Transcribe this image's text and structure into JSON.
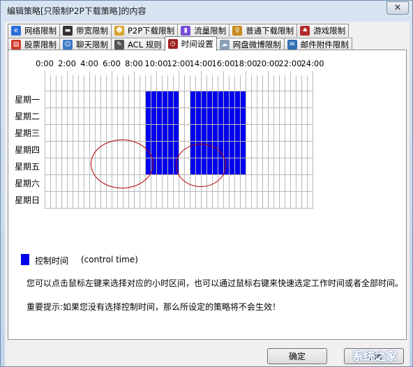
{
  "window": {
    "title": "编辑策略[只限制P2P下载策略]的内容",
    "close_label": "✕"
  },
  "tabs_row1": [
    {
      "label": "网络限制",
      "icon": "ie-globe-icon",
      "color": "#2a6fd6",
      "glyph": "e"
    },
    {
      "label": "带宽限制",
      "icon": "monitor-icon",
      "color": "#333333",
      "glyph": "▬"
    },
    {
      "label": "P2P下载限制",
      "icon": "user-icon",
      "color": "#d9a531",
      "glyph": "☻"
    },
    {
      "label": "流量限制",
      "icon": "bar-chart-icon",
      "color": "#7a4fd8",
      "glyph": "▮"
    },
    {
      "label": "普通下载限制",
      "icon": "person-icon",
      "color": "#c98a1c",
      "glyph": "♀"
    },
    {
      "label": "游戏限制",
      "icon": "game-icon",
      "color": "#b52b2b",
      "glyph": "♠"
    }
  ],
  "tabs_row2": [
    {
      "label": "股票限制",
      "icon": "stock-icon",
      "color": "#d23b2b",
      "glyph": "▤"
    },
    {
      "label": "聊天限制",
      "icon": "chat-icon",
      "color": "#3a7ac8",
      "glyph": "☺"
    },
    {
      "label": "ACL 规则",
      "icon": "acl-icon",
      "color": "#555555",
      "glyph": "✎"
    },
    {
      "label": "时间设置",
      "icon": "clock-icon",
      "color": "#a02020",
      "glyph": "◷",
      "active": true
    },
    {
      "label": "网盘微博限制",
      "icon": "cloud-icon",
      "color": "#8aa0b8",
      "glyph": "☁"
    },
    {
      "label": "邮件附件限制",
      "icon": "mail-icon",
      "color": "#2f6fb5",
      "glyph": "✉"
    }
  ],
  "schedule": {
    "hour_labels": [
      "0:00",
      "2:00",
      "4:00",
      "6:00",
      "8:00",
      "10:00",
      "12:00",
      "14:00",
      "16:00",
      "18:00",
      "20:00",
      "22:00",
      "24:00"
    ],
    "days": [
      "星期一",
      "星期二",
      "星期三",
      "星期四",
      "星期五",
      "星期六",
      "星期日"
    ],
    "slots_per_day": 48,
    "selected": {
      "星期一": [
        [
          18,
          23
        ],
        [
          26,
          35
        ]
      ],
      "星期二": [
        [
          18,
          23
        ],
        [
          26,
          35
        ]
      ],
      "星期三": [
        [
          18,
          23
        ],
        [
          26,
          35
        ]
      ],
      "星期四": [
        [
          18,
          23
        ],
        [
          26,
          35
        ]
      ],
      "星期五": [
        [
          18,
          23
        ],
        [
          26,
          35
        ]
      ],
      "星期六": [],
      "星期日": []
    },
    "selected_color": "#0000ee"
  },
  "legend": {
    "label": "控制时间",
    "english": "(control time)"
  },
  "hint": "您可以点击鼠标左键来选择对应的小时区间，也可以通过鼠标右键来快速选定工作时间或者全部时间。",
  "warning": "重要提示:如果您没有选择控制时间，那么所设定的策略将不会生效！",
  "buttons": {
    "ok": "确定",
    "cancel": "取消"
  },
  "watermark": "系统之家"
}
